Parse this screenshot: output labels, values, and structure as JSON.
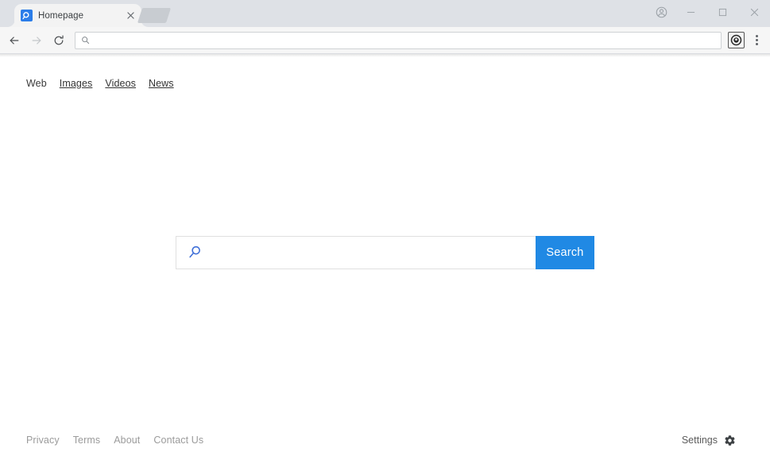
{
  "browser": {
    "tab": {
      "title": "Homepage",
      "favicon_name": "search-favicon",
      "close_label": "×"
    },
    "newtab_button_name": "new-tab-button",
    "window_controls": {
      "profile": "profile-avatar-icon",
      "minimize": "—",
      "maximize": "□",
      "close": "×"
    },
    "toolbar": {
      "back": "←",
      "forward": "→",
      "reload": "↻",
      "omnibox_value": "",
      "omnibox_placeholder": "",
      "extension_name": "extension-icon",
      "menu_name": "chrome-menu-button"
    }
  },
  "page": {
    "topnav": [
      {
        "label": "Web",
        "active": true
      },
      {
        "label": "Images",
        "active": false
      },
      {
        "label": "Videos",
        "active": false
      },
      {
        "label": "News",
        "active": false
      }
    ],
    "search": {
      "value": "",
      "placeholder": "",
      "button_label": "Search",
      "accent_color": "#2089e4",
      "icon_name": "search-icon"
    },
    "footer": {
      "links": [
        "Privacy",
        "Terms",
        "About",
        "Contact Us"
      ],
      "settings_label": "Settings",
      "settings_icon": "gear-icon"
    }
  }
}
